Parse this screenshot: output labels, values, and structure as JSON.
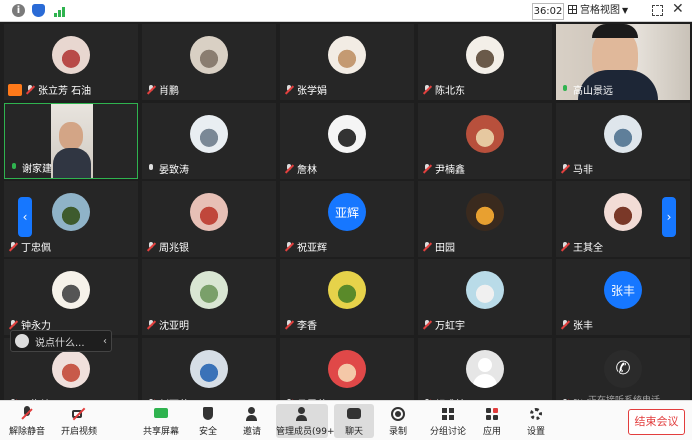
{
  "topbar": {
    "timer": "36:02",
    "view_label": "宫格视图"
  },
  "tiles": [
    {
      "name": "张立芳 石油",
      "avatar": "photo",
      "mic": "muted",
      "host": true
    },
    {
      "name": "肖鹏",
      "avatar": "photo",
      "mic": "muted"
    },
    {
      "name": "张学娟",
      "avatar": "photo",
      "mic": "muted"
    },
    {
      "name": "陈北东",
      "avatar": "photo",
      "mic": "muted"
    },
    {
      "name": "高山景远",
      "avatar": "video",
      "mic": "on"
    },
    {
      "name": "谢家建",
      "avatar": "video",
      "mic": "on",
      "active": true
    },
    {
      "name": "晏致涛",
      "avatar": "photo",
      "mic": "plain"
    },
    {
      "name": "詹林",
      "avatar": "photo",
      "mic": "muted"
    },
    {
      "name": "尹楠鑫",
      "avatar": "photo",
      "mic": "muted"
    },
    {
      "name": "马非",
      "avatar": "photo",
      "mic": "muted"
    },
    {
      "name": "丁忠佩",
      "avatar": "photo",
      "mic": "muted"
    },
    {
      "name": "周兆银",
      "avatar": "photo",
      "mic": "muted"
    },
    {
      "name": "祝亚辉",
      "avatar": "text",
      "avatar_text": "亚辉",
      "mic": "muted"
    },
    {
      "name": "田园",
      "avatar": "photo",
      "mic": "muted"
    },
    {
      "name": "王其全",
      "avatar": "photo",
      "mic": "muted"
    },
    {
      "name": "钟永力",
      "avatar": "photo",
      "mic": "muted"
    },
    {
      "name": "沈亚明",
      "avatar": "photo",
      "mic": "muted"
    },
    {
      "name": "李香",
      "avatar": "photo",
      "mic": "muted"
    },
    {
      "name": "万虹宇",
      "avatar": "photo",
      "mic": "muted"
    },
    {
      "name": "张丰",
      "avatar": "text",
      "avatar_text": "张丰",
      "mic": "muted"
    },
    {
      "name": "丁海涛",
      "avatar": "photo",
      "mic": "muted"
    },
    {
      "name": "刘丽萍",
      "avatar": "photo",
      "mic": "muted"
    },
    {
      "name": "吕雪茹",
      "avatar": "photo",
      "mic": "muted"
    },
    {
      "name": "颜成林",
      "avatar": "blank",
      "mic": "muted"
    },
    {
      "name": "张杰",
      "avatar": "phone",
      "mic": "muted"
    }
  ],
  "chat_placeholder": "说点什么...",
  "call_note": "正在接听系统电话",
  "toolbar": {
    "unmute": "解除静音",
    "start_video": "开启视频",
    "share": "共享屏幕",
    "security": "安全",
    "invite": "邀请",
    "members": "管理成员(99+)",
    "chat": "聊天",
    "record": "录制",
    "breakout": "分组讨论",
    "apps": "应用",
    "settings": "设置",
    "end": "结束会议"
  },
  "colors": {
    "accent": "#1677ff",
    "end": "#e23d3d",
    "host_badge": "#ff7a1a",
    "mic_on": "#2fb34f"
  }
}
